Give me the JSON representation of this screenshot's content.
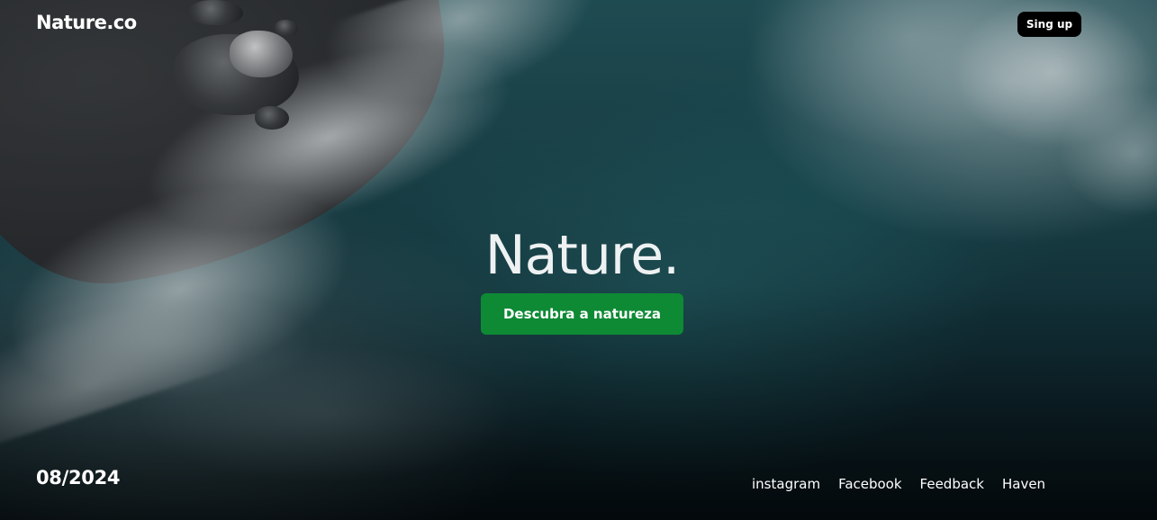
{
  "header": {
    "logo": "Nature.co",
    "signup_label": "Sing up"
  },
  "hero": {
    "title": "Nature.",
    "cta_label": "Descubra a natureza",
    "background": "aerial-ocean-waves-image"
  },
  "footer": {
    "date": "08/2024",
    "links": [
      {
        "label": "instagram"
      },
      {
        "label": "Facebook"
      },
      {
        "label": "Feedback"
      },
      {
        "label": "Haven"
      }
    ]
  },
  "colors": {
    "cta": "#0e8a35",
    "signup_bg": "#000000",
    "text": "#ffffff"
  }
}
